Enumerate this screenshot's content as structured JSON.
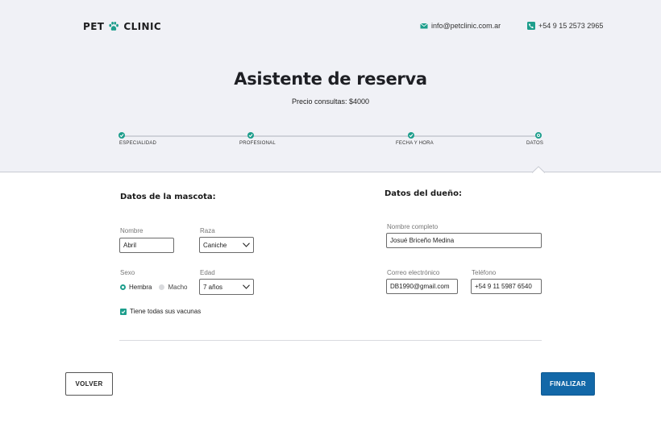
{
  "header": {
    "logo_left": "PET",
    "logo_right": "CLINIC",
    "logo_icon": "paw-icon",
    "email": "info@petclinic.com.ar",
    "email_icon": "envelope-icon",
    "phone": "+54 9 15 2573 2965",
    "phone_icon": "phone-icon"
  },
  "hero": {
    "title": "Asistente de reserva",
    "subtitle": "Precio consultas: $4000"
  },
  "steps": [
    {
      "label": "ESPECIALIDAD",
      "state": "done"
    },
    {
      "label": "PROFESIONAL",
      "state": "done"
    },
    {
      "label": "FECHA Y HORA",
      "state": "done"
    },
    {
      "label": "DATOS",
      "state": "current"
    }
  ],
  "pet_section": {
    "title": "Datos de la mascota:",
    "name_label": "Nombre",
    "name_value": "Abril",
    "breed_label": "Raza",
    "breed_value": "Caniche",
    "sex_label": "Sexo",
    "sex_options": [
      "Hembra",
      "Macho"
    ],
    "sex_selected": "Hembra",
    "age_label": "Edad",
    "age_value": "7 años",
    "vaccines_label": "Tiene todas sus vacunas",
    "vaccines_checked": true
  },
  "owner_section": {
    "title": "Datos del dueño:",
    "fullname_label": "Nombre completo",
    "fullname_value": "Josué Briceño Medina",
    "email_label": "Correo electrónico",
    "email_value": "DB1990@gmail.com",
    "phone_label": "Teléfono",
    "phone_value": "+54 9 11 5987 6540"
  },
  "actions": {
    "back_label": "VOLVER",
    "finish_label": "FINALIZAR"
  },
  "colors": {
    "accent": "#1d9e8c",
    "primary_button": "#1368a8",
    "hero_bg": "#f0f1f6"
  }
}
